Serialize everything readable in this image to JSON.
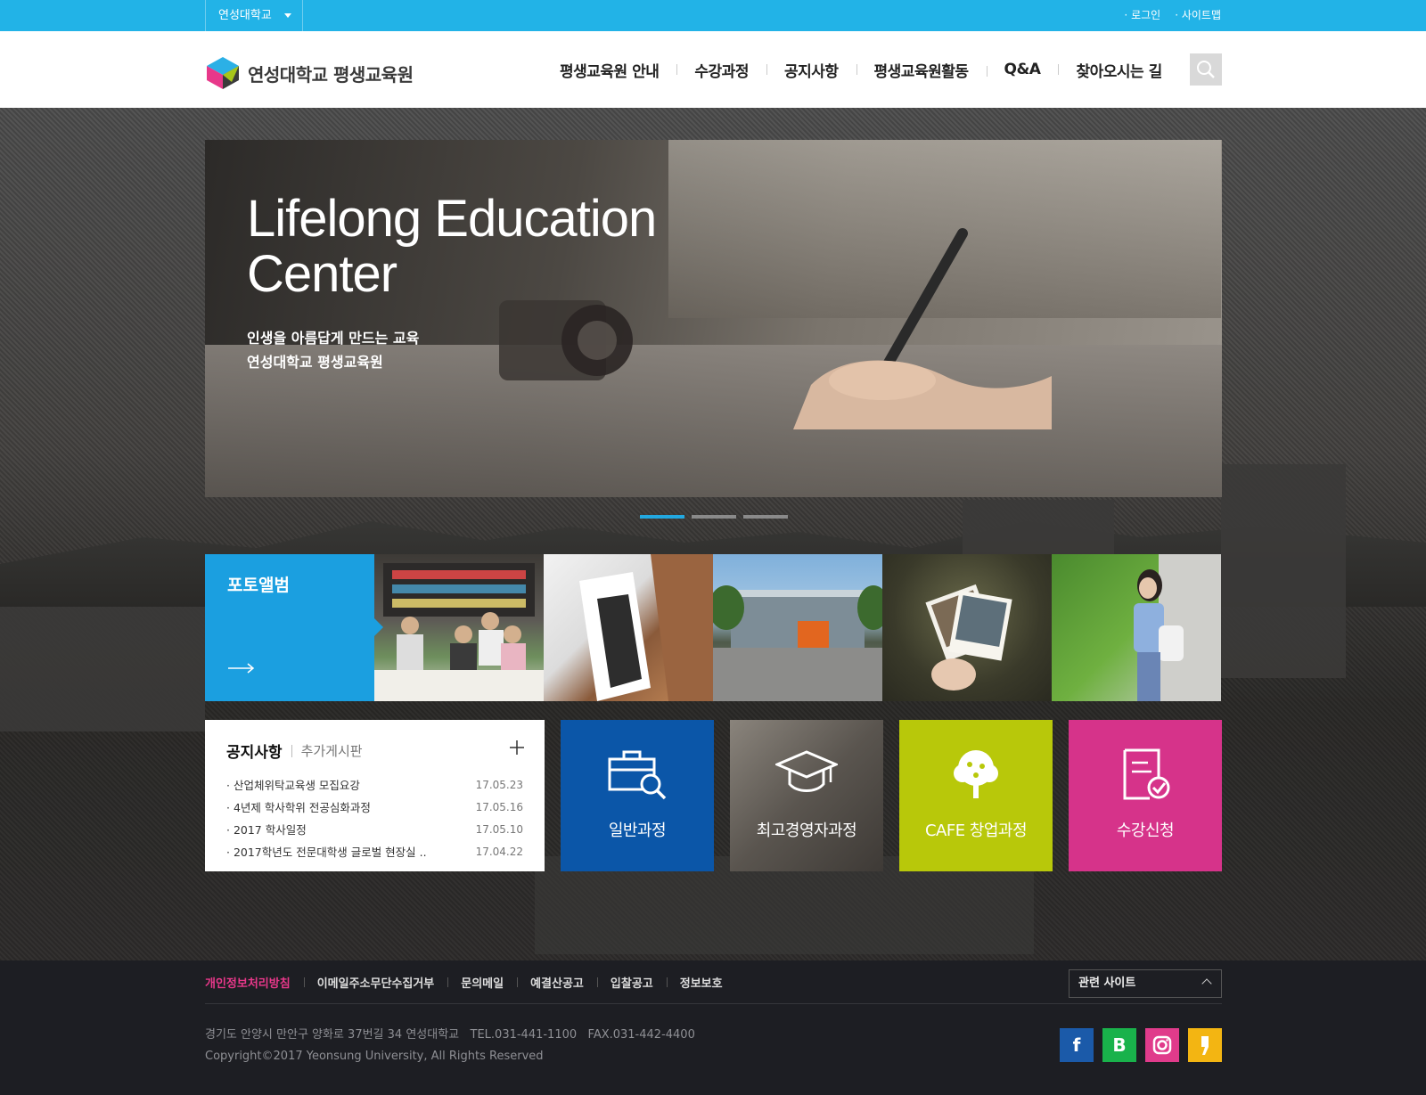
{
  "topbar": {
    "university_select": "연성대학교",
    "login": "로그인",
    "sitemap": "사이트맵"
  },
  "header": {
    "logo_text": "연성대학교 평생교육원",
    "nav": [
      "평생교육원 안내",
      "수강과정",
      "공지사항",
      "평생교육원활동",
      "Q&A",
      "찾아오시는 길"
    ]
  },
  "hero": {
    "title_line1": "Lifelong Education",
    "title_line2": "Center",
    "sub_line1": "인생을 아름답게 만드는 교육",
    "sub_line2": "연성대학교 평생교육원",
    "slides_total": 3,
    "active_slide": 1
  },
  "album": {
    "title": "포토앨범"
  },
  "notice": {
    "title": "공지사항",
    "extra_tab": "추가게시판",
    "items": [
      {
        "text": "산업체위탁교육생 모집요강",
        "date": "17.05.23"
      },
      {
        "text": "4년제 학사학위 전공심화과정",
        "date": "17.05.16"
      },
      {
        "text": "2017 학사일정",
        "date": "17.05.10"
      },
      {
        "text": "2017학년도 전문대학생 글로벌 현장실 ..",
        "date": "17.04.22"
      }
    ]
  },
  "quick": [
    {
      "label": "일반과정",
      "color": "#0b56a8",
      "icon": "briefcase-search-icon"
    },
    {
      "label": "최고경영자과정",
      "color": "#6e6a65",
      "icon": "graduation-cap-icon"
    },
    {
      "label": "CAFE 창업과정",
      "color": "#b8c80a",
      "icon": "tree-icon"
    },
    {
      "label": "수강신청",
      "color": "#d6338a",
      "icon": "document-check-icon"
    }
  ],
  "footer": {
    "links": [
      "개인정보처리방침",
      "이메일주소무단수집거부",
      "문의메일",
      "예결산공고",
      "입찰공고",
      "정보보호"
    ],
    "related_site": "관련 사이트",
    "address": "경기도 안양시 만안구 양화로 37번길 34 연성대학교   TEL.031-441-1100   FAX.031-442-4400",
    "copyright": "Copyright©2017 Yeonsung University, All Rights Reserved",
    "social": [
      {
        "name": "facebook",
        "glyph": "f",
        "color": "#1b5aa9"
      },
      {
        "name": "blog",
        "glyph": "B",
        "color": "#19b24b"
      },
      {
        "name": "instagram",
        "glyph": "◎",
        "color": "#e03b8b"
      },
      {
        "name": "kakao-story",
        "glyph": "❜",
        "color": "#f3b512"
      }
    ]
  }
}
